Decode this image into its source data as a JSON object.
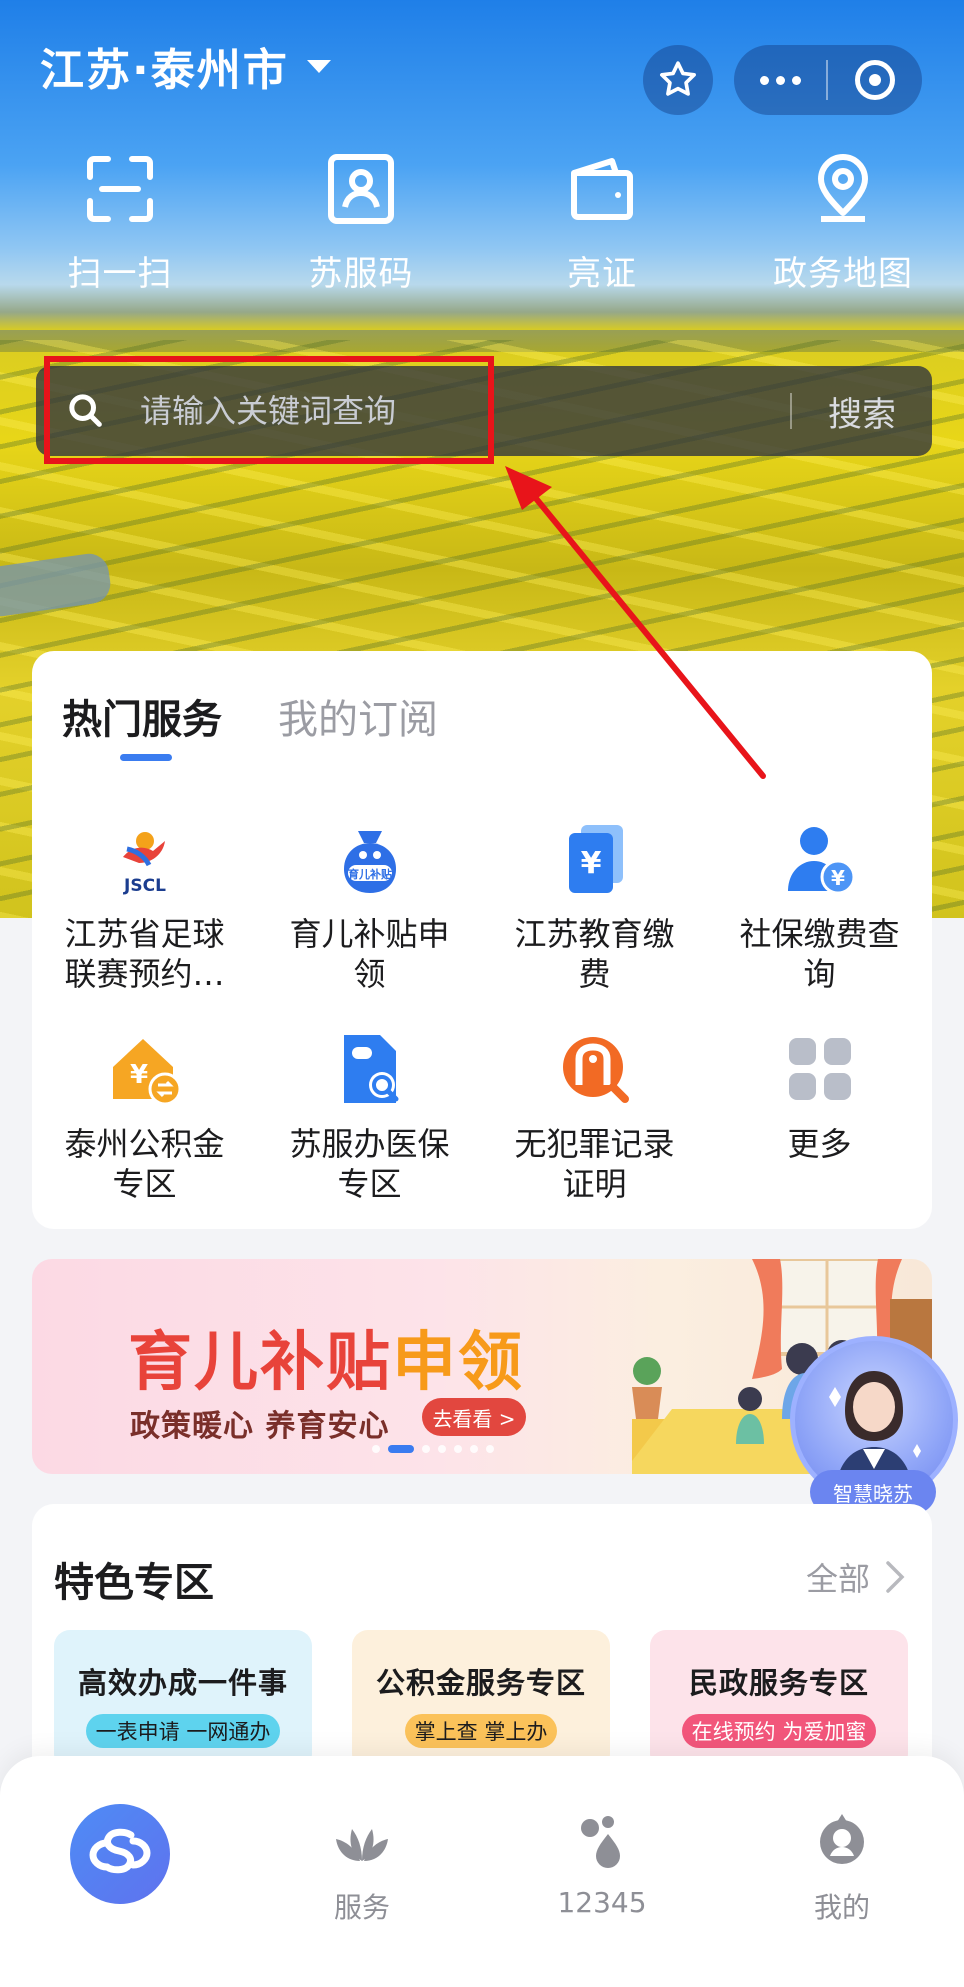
{
  "header": {
    "location": "江苏·泰州市"
  },
  "quick_actions": [
    {
      "label": "扫一扫",
      "icon": "scan-icon"
    },
    {
      "label": "苏服码",
      "icon": "id-card-icon"
    },
    {
      "label": "亮证",
      "icon": "wallet-icon"
    },
    {
      "label": "政务地图",
      "icon": "map-pin-icon"
    }
  ],
  "search": {
    "placeholder": "请输入关键词查询",
    "button_label": "搜索"
  },
  "services": {
    "tabs": [
      "热门服务",
      "我的订阅"
    ],
    "items": [
      {
        "label": "江苏省足球联赛预约…",
        "icon": "jscl-logo-icon"
      },
      {
        "label": "育儿补贴申领",
        "icon": "childcare-bag-icon"
      },
      {
        "label": "江苏教育缴费",
        "icon": "education-fee-icon"
      },
      {
        "label": "社保缴费查询",
        "icon": "social-security-icon"
      },
      {
        "label": "泰州公积金专区",
        "icon": "housing-fund-icon"
      },
      {
        "label": "苏服办医保专区",
        "icon": "medical-insurance-icon"
      },
      {
        "label": "无犯罪记录证明",
        "icon": "no-criminal-record-icon"
      },
      {
        "label": "更多",
        "icon": "more-grid-icon"
      }
    ]
  },
  "banner": {
    "title_main": "育儿补贴",
    "title_highlight": "申领",
    "subtitle": "政策暖心  养育安心",
    "button_label": "去看看 >",
    "page_count": 7,
    "active_page": 1
  },
  "assistant": {
    "label": "智慧晓苏"
  },
  "feature": {
    "title": "特色专区",
    "all_label": "全部",
    "cards": [
      {
        "title": "高效办成一件事",
        "tag": "一表申请 一网通办",
        "bg": "#dff3fb",
        "pill": "#5ed3ee"
      },
      {
        "title": "公积金服务专区",
        "tag": "掌上查 掌上办",
        "bg": "#fdf0dc",
        "pill": "#fbc25a"
      },
      {
        "title": "民政服务专区",
        "tag": "在线预约 为爱加蜜",
        "bg": "#fde3ea",
        "pill": "#f2567b"
      }
    ]
  },
  "tabbar": {
    "items": [
      {
        "label": "",
        "icon": "home-logo-icon"
      },
      {
        "label": "服务",
        "icon": "lotus-icon"
      },
      {
        "label": "12345",
        "icon": "hotline-drops-icon"
      },
      {
        "label": "我的",
        "icon": "profile-icon"
      }
    ]
  },
  "colors": {
    "accent": "#3a7cf0",
    "annotation": "#e8141a"
  }
}
